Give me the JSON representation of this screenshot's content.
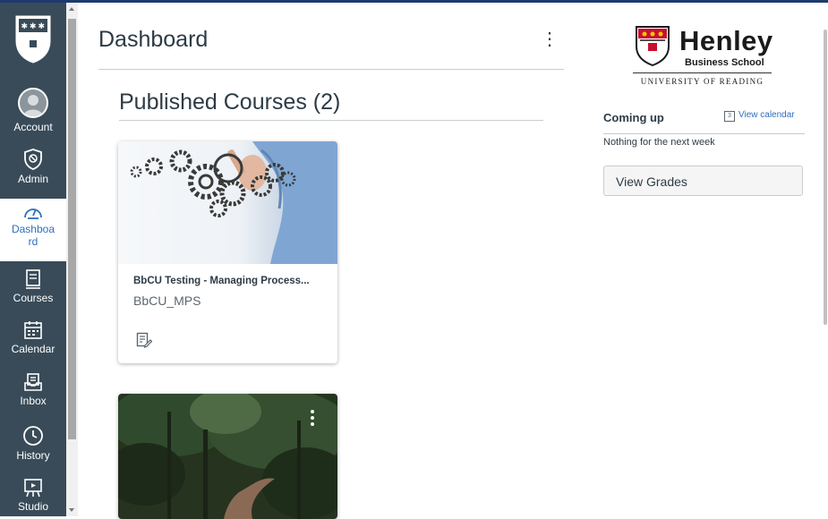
{
  "nav": {
    "items": [
      {
        "label": "Account",
        "icon": "account-avatar-icon"
      },
      {
        "label": "Admin",
        "icon": "admin-shield-icon"
      },
      {
        "label": "Dashboa\nrd",
        "icon": "dashboard-speedometer-icon",
        "active": true
      },
      {
        "label": "Courses",
        "icon": "courses-book-icon"
      },
      {
        "label": "Calendar",
        "icon": "calendar-icon"
      },
      {
        "label": "Inbox",
        "icon": "inbox-icon"
      },
      {
        "label": "History",
        "icon": "history-clock-icon"
      },
      {
        "label": "Studio",
        "icon": "studio-icon"
      }
    ]
  },
  "main": {
    "title": "Dashboard",
    "section_title": "Published Courses (2)",
    "cards": [
      {
        "title": "BbCU Testing - Managing Process...",
        "code": "BbCU_MPS",
        "image": "gears-hand-image"
      },
      {
        "title": "",
        "code": "",
        "image": "forest-path-image"
      }
    ]
  },
  "sidebar": {
    "brand": {
      "name": "Henley",
      "sub": "Business School",
      "university": "UNIVERSITY OF READING"
    },
    "coming_up": "Coming up",
    "calendar_day": "3",
    "view_calendar": "View calendar",
    "nothing": "Nothing for the next week",
    "view_grades": "View Grades"
  },
  "colors": {
    "nav_bg": "#394b58",
    "accent": "#2d6fbf",
    "text": "#2d3b45",
    "crest_red": "#c8102e",
    "crest_gold": "#f2c400"
  }
}
